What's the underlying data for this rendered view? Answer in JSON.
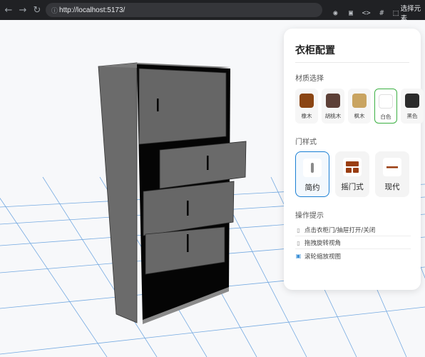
{
  "browser": {
    "url": "http://localhost:5173/",
    "select_element_label": "选择元素",
    "icons": [
      "back-icon",
      "forward-icon",
      "reload-icon",
      "site-info-icon"
    ]
  },
  "panel": {
    "title": "衣柜配置",
    "material_section": "材质选择",
    "materials": [
      {
        "label": "橡木",
        "color": "#8B4513",
        "selected": false
      },
      {
        "label": "胡桃木",
        "color": "#5D4037",
        "selected": false
      },
      {
        "label": "枫木",
        "color": "#C9A461",
        "selected": false
      },
      {
        "label": "白色",
        "color": "#FFFFFF",
        "selected": true
      },
      {
        "label": "黑色",
        "color": "#2B2B2B",
        "selected": false
      }
    ],
    "door_section": "门样式",
    "door_styles": [
      {
        "label": "简约",
        "selected": true,
        "icon": "minimal-handle-icon"
      },
      {
        "label": "摇门式",
        "selected": false,
        "icon": "panel-door-icon"
      },
      {
        "label": "现代",
        "selected": false,
        "icon": "modern-bar-icon"
      }
    ],
    "tips_section": "操作提示",
    "tips": [
      {
        "text": "点击衣柜门/抽屉打开/关闭",
        "icon": "pointer-icon"
      },
      {
        "text": "拖拽旋转视角",
        "icon": "drag-icon"
      },
      {
        "text": "滚轮缩放视图",
        "icon": "zoom-icon"
      }
    ]
  },
  "colors": {
    "accent_selected_material": "#3cb043",
    "accent_selected_door": "#1a7fd4",
    "grid_line": "#4a90d9",
    "cabinet_body": "#6b6b6b",
    "cabinet_interior": "#050505"
  }
}
